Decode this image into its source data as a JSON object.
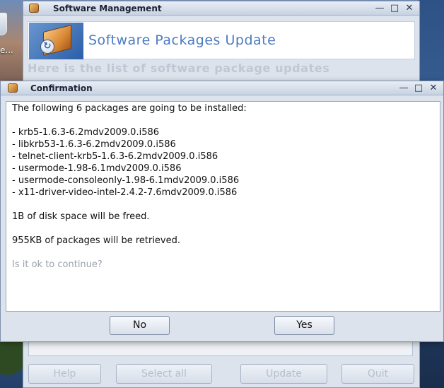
{
  "desktop": {
    "icon_label": "e..."
  },
  "management_window": {
    "title": "Software Management",
    "controls": {
      "minimize": "—",
      "maximize": "□",
      "close": "✕"
    },
    "header_title": "Software Packages Update",
    "subtitle": "Here is the list of software package updates",
    "buttons": {
      "help": "Help",
      "select_all": "Select all",
      "update": "Update",
      "quit": "Quit"
    }
  },
  "confirm_dialog": {
    "title": "Confirmation",
    "controls": {
      "minimize": "—",
      "maximize": "□",
      "close": "✕"
    },
    "intro": "The following 6 packages are going to be installed:",
    "packages": [
      "- krb5-1.6.3-6.2mdv2009.0.i586",
      "- libkrb53-1.6.3-6.2mdv2009.0.i586",
      "- telnet-client-krb5-1.6.3-6.2mdv2009.0.i586",
      "- usermode-1.98-6.1mdv2009.0.i586",
      "- usermode-consoleonly-1.98-6.1mdv2009.0.i586",
      "- x11-driver-video-intel-2.4.2-7.6mdv2009.0.i586"
    ],
    "disk_space": "1B of disk space will be freed.",
    "retrieved": "955KB of packages will be retrieved.",
    "question": "Is it ok to continue?",
    "no_label": "No",
    "yes_label": "Yes"
  },
  "colors": {
    "header_title": "#4a7cc2",
    "titlebar": "#c7d2e2",
    "dialog_bg": "#dde3ec"
  }
}
